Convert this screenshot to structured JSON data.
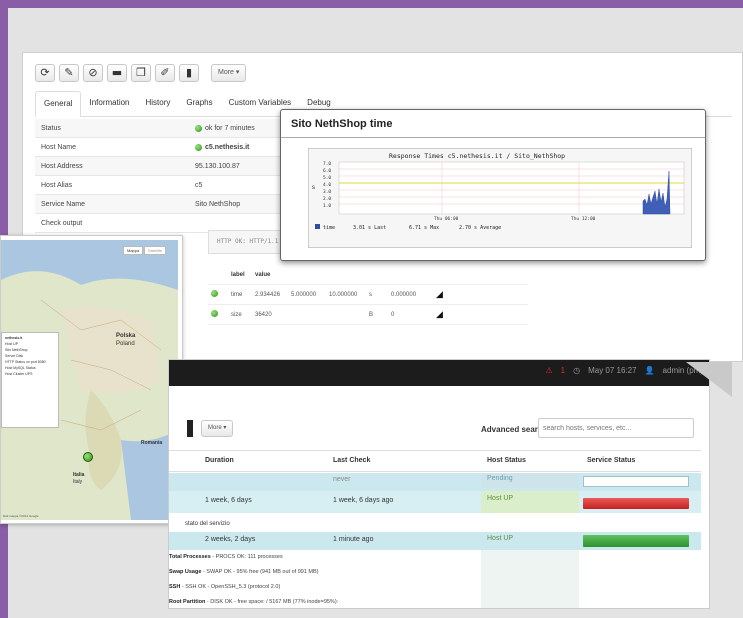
{
  "colors": {
    "frame": "#8a5ea6",
    "ok": "#2f8f1d",
    "critical": "#c82020",
    "up": "#2e8f2e",
    "pending": "#6aa0b3"
  },
  "toolbar": {
    "icons": [
      "refresh-icon",
      "edit-icon",
      "block-icon",
      "server-icon",
      "copy-icon",
      "pencil-icon",
      "delete-icon"
    ],
    "more_label": "More"
  },
  "tabs": [
    "General",
    "Information",
    "History",
    "Graphs",
    "Custom Variables",
    "Debug"
  ],
  "properties": [
    {
      "key": "Status",
      "value": "ok for 7 minutes"
    },
    {
      "key": "Host Name",
      "value": "c5.nethesis.it"
    },
    {
      "key": "Host Address",
      "value": "95.130.100.87"
    },
    {
      "key": "Host Alias",
      "value": "c5"
    },
    {
      "key": "Service Name",
      "value": "Sito NethShop"
    },
    {
      "key": "Check output",
      "value": ""
    }
  ],
  "check_output_text": "HTTP OK: HTTP/1.1",
  "perf": {
    "headers": [
      "label",
      "value"
    ],
    "rows": [
      [
        "time",
        "2.934426",
        "5.000000",
        "10.000000",
        "s",
        "0.000000"
      ],
      [
        "size",
        "36420",
        "",
        "",
        "B",
        "0"
      ]
    ]
  },
  "graph": {
    "title": "Sito NethShop time",
    "chart_title": "Response Times c5.nethesis.it / Sito_NethShop",
    "yaxis": [
      "7.0",
      "6.0",
      "5.0",
      "4.0",
      "3.0",
      "2.0",
      "1.0"
    ],
    "ylabel": "s",
    "xaxis": [
      "Thu 06:00",
      "Thu 12:00"
    ],
    "legend": {
      "series": "time",
      "last": "3.01 s Last",
      "max": "6.71 s Max",
      "avg": "2.70 s Average"
    }
  },
  "map": {
    "tabs": [
      "Mappa",
      "Satellite"
    ],
    "countries": [
      "Polska",
      "Poland",
      "Romania",
      "Italia",
      "Italy"
    ],
    "popup_title": "nethesis.it",
    "popup_lines": [
      "Host UP",
      "Sito NethShop",
      "Server Disk",
      "HTTP Status on port 8080",
      "Host MySQL Status",
      "Host Cluster UPS"
    ],
    "footer": "Dati mappa ©2014 Google"
  },
  "header": {
    "warnings": "1",
    "datetime": "May 07 16:27",
    "user": "admin (pm)"
  },
  "list": {
    "more_label": "More",
    "advanced_search": "Advanced search",
    "search_placeholder": "search hosts, services, etc...",
    "columns": [
      "Duration",
      "Last Check",
      "Host Status",
      "Service Status"
    ],
    "row1": {
      "last_check": "never",
      "host_status": "Pending"
    },
    "row2": {
      "duration": "1 week, 6 days",
      "last_check": "1 week, 6 days ago",
      "host_status": "Host UP"
    },
    "row3_label": "stato del servizio",
    "row3": {
      "duration": "2 weeks, 2 days",
      "last_check": "1 minute ago",
      "host_status": "Host UP"
    },
    "services": [
      {
        "name": "Total Processes",
        "text": " - PROCS OK: 111 processes"
      },
      {
        "name": "Swap Usage",
        "text": " - SWAP OK - 95% free (941 MB out of 991 MB)"
      },
      {
        "name": "SSH",
        "text": " - SSH OK - OpenSSH_5.3 (protocol 2.0)"
      },
      {
        "name": "Root Partition",
        "text": " - DISK OK - free space: / 5167 MB (77% inode=95%):"
      }
    ]
  }
}
